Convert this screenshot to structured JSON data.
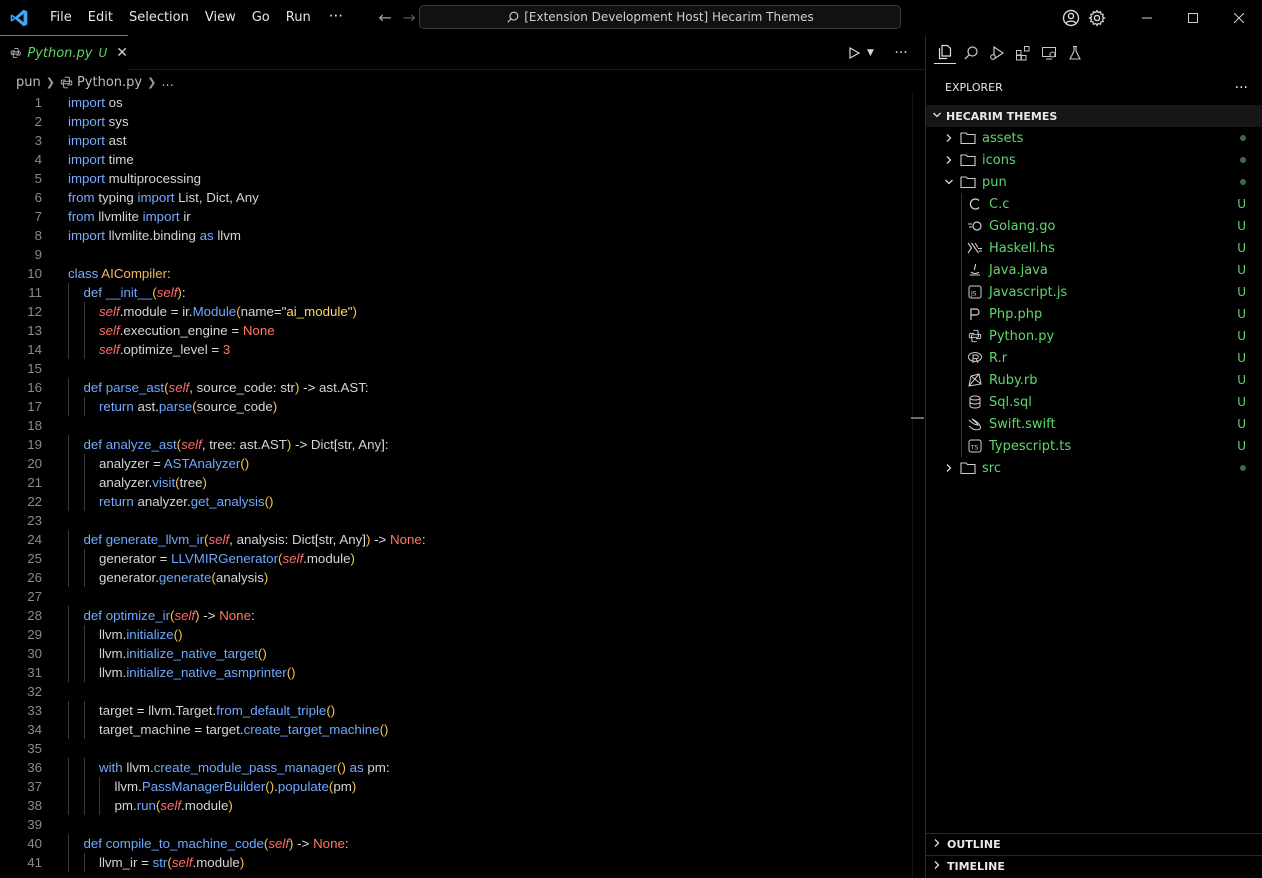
{
  "menu": [
    "File",
    "Edit",
    "Selection",
    "View",
    "Go",
    "Run"
  ],
  "command_center": "[Extension Development Host] Hecarim Themes",
  "tab": {
    "label": "Python.py",
    "modified": "U"
  },
  "breadcrumbs": [
    "pun",
    "Python.py",
    "..."
  ],
  "explorer": {
    "title": "EXPLORER",
    "root": "HECARIM THEMES",
    "items": [
      {
        "name": "assets",
        "type": "folder",
        "expanded": false,
        "status": ""
      },
      {
        "name": "icons",
        "type": "folder",
        "expanded": false,
        "status": ""
      },
      {
        "name": "pun",
        "type": "folder",
        "expanded": true,
        "status": ""
      },
      {
        "name": "C.c",
        "type": "file",
        "icon": "c-file-icon",
        "status": "U"
      },
      {
        "name": "Golang.go",
        "type": "file",
        "icon": "go-file-icon",
        "status": "U"
      },
      {
        "name": "Haskell.hs",
        "type": "file",
        "icon": "haskell-file-icon",
        "status": "U"
      },
      {
        "name": "Java.java",
        "type": "file",
        "icon": "java-file-icon",
        "status": "U"
      },
      {
        "name": "Javascript.js",
        "type": "file",
        "icon": "javascript-file-icon",
        "status": "U"
      },
      {
        "name": "Php.php",
        "type": "file",
        "icon": "php-file-icon",
        "status": "U"
      },
      {
        "name": "Python.py",
        "type": "file",
        "icon": "python-file-icon",
        "status": "U"
      },
      {
        "name": "R.r",
        "type": "file",
        "icon": "r-file-icon",
        "status": "U"
      },
      {
        "name": "Ruby.rb",
        "type": "file",
        "icon": "ruby-file-icon",
        "status": "U"
      },
      {
        "name": "Sql.sql",
        "type": "file",
        "icon": "sql-file-icon",
        "status": "U"
      },
      {
        "name": "Swift.swift",
        "type": "file",
        "icon": "swift-file-icon",
        "status": "U"
      },
      {
        "name": "Typescript.ts",
        "type": "file",
        "icon": "typescript-file-icon",
        "status": "U"
      },
      {
        "name": "src",
        "type": "folder",
        "expanded": false,
        "status": ""
      }
    ],
    "outline": "OUTLINE",
    "timeline": "TIMELINE"
  },
  "code_lines": [
    "import os",
    "import sys",
    "import ast",
    "import time",
    "import multiprocessing",
    "from typing import List, Dict, Any",
    "from llvmlite import ir",
    "import llvmlite.binding as llvm",
    "",
    "class AICompiler:",
    "    def __init__(self):",
    "        self.module = ir.Module(name=\"ai_module\")",
    "        self.execution_engine = None",
    "        self.optimize_level = 3",
    "",
    "    def parse_ast(self, source_code: str) -> ast.AST:",
    "        return ast.parse(source_code)",
    "",
    "    def analyze_ast(self, tree: ast.AST) -> Dict[str, Any]:",
    "        analyzer = ASTAnalyzer()",
    "        analyzer.visit(tree)",
    "        return analyzer.get_analysis()",
    "",
    "    def generate_llvm_ir(self, analysis: Dict[str, Any]) -> None:",
    "        generator = LLVMIRGenerator(self.module)",
    "        generator.generate(analysis)",
    "",
    "    def optimize_ir(self) -> None:",
    "        llvm.initialize()",
    "        llvm.initialize_native_target()",
    "        llvm.initialize_native_asmprinter()",
    "",
    "        target = llvm.Target.from_default_triple()",
    "        target_machine = target.create_target_machine()",
    "",
    "        with llvm.create_module_pass_manager() as pm:",
    "            llvm.PassManagerBuilder().populate(pm)",
    "            pm.run(self.module)",
    "",
    "    def compile_to_machine_code(self) -> None:",
    "        llvm_ir = str(self.module)"
  ],
  "colors": {
    "accent_green": "#5ed76b",
    "keyword": "#78aaff",
    "function": "#f2c14e",
    "self": "#ff6a6a",
    "string": "#ffd866"
  }
}
